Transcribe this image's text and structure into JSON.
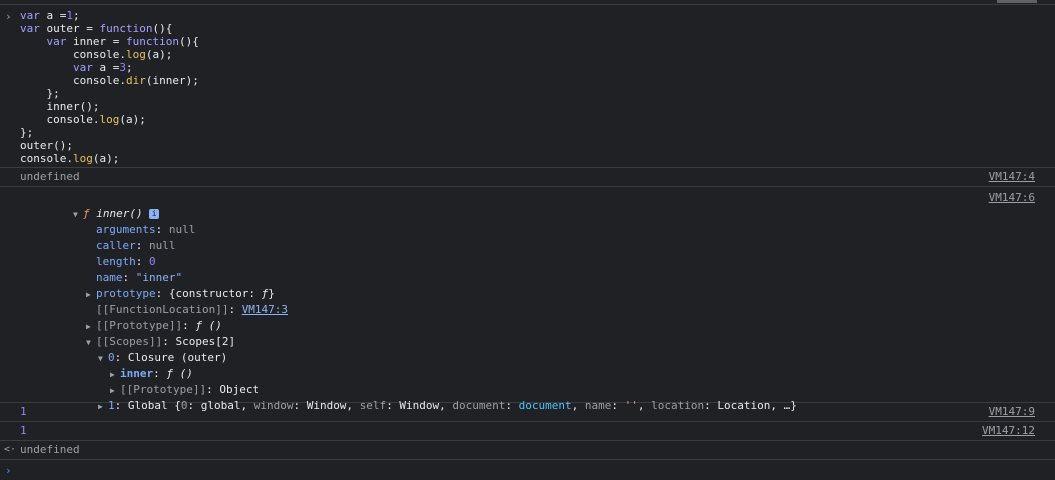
{
  "code_lines": [
    [
      {
        "t": "var ",
        "c": "kw"
      },
      {
        "t": "a =",
        "c": "plain"
      },
      {
        "t": "1",
        "c": "num"
      },
      {
        "t": ";",
        "c": "plain"
      }
    ],
    [
      {
        "t": "var ",
        "c": "kw"
      },
      {
        "t": "outer = ",
        "c": "plain"
      },
      {
        "t": "function",
        "c": "kw"
      },
      {
        "t": "(){",
        "c": "plain"
      }
    ],
    [
      {
        "t": "    var ",
        "c": "kw"
      },
      {
        "t": "inner = ",
        "c": "plain"
      },
      {
        "t": "function",
        "c": "kw"
      },
      {
        "t": "(){",
        "c": "plain"
      }
    ],
    [
      {
        "t": "        console.",
        "c": "plain"
      },
      {
        "t": "log",
        "c": "fn"
      },
      {
        "t": "(a);",
        "c": "plain"
      }
    ],
    [
      {
        "t": "        var ",
        "c": "kw"
      },
      {
        "t": "a =",
        "c": "plain"
      },
      {
        "t": "3",
        "c": "num"
      },
      {
        "t": ";",
        "c": "plain"
      }
    ],
    [
      {
        "t": "        console.",
        "c": "plain"
      },
      {
        "t": "dir",
        "c": "fn"
      },
      {
        "t": "(inner);",
        "c": "plain"
      }
    ],
    [
      {
        "t": "    };",
        "c": "plain"
      }
    ],
    [
      {
        "t": "    inner();",
        "c": "plain"
      }
    ],
    [
      {
        "t": "    console.",
        "c": "plain"
      },
      {
        "t": "log",
        "c": "fn"
      },
      {
        "t": "(a);",
        "c": "plain"
      }
    ],
    [
      {
        "t": "};",
        "c": "plain"
      }
    ],
    [
      {
        "t": "outer();",
        "c": "plain"
      }
    ],
    [
      {
        "t": "console.",
        "c": "plain"
      },
      {
        "t": "log",
        "c": "fn"
      },
      {
        "t": "(a);",
        "c": "plain"
      }
    ]
  ],
  "entries": {
    "undefined1": {
      "text": "undefined",
      "source": "VM147:4"
    },
    "dir_source": "VM147:6",
    "log1": {
      "text": "1",
      "source": "VM147:9"
    },
    "log2": {
      "text": "1",
      "source": "VM147:12"
    },
    "undefined2": {
      "text": "undefined"
    }
  },
  "tree": {
    "f_symbol": "ƒ",
    "fn_name": "inner()",
    "info_badge": "i",
    "arguments_key": "arguments",
    "arguments_val": "null",
    "caller_key": "caller",
    "caller_val": "null",
    "length_key": "length",
    "length_val": "0",
    "name_key": "name",
    "name_val": "\"inner\"",
    "prototype_key": "prototype",
    "prototype_val_pre": "{constructor: ",
    "prototype_val_f": "ƒ",
    "prototype_val_post": "}",
    "fnloc_key": "[[FunctionLocation]]",
    "fnloc_val": "VM147:3",
    "proto_key": "[[Prototype]]",
    "proto_val": "ƒ ()",
    "scopes_key": "[[Scopes]]",
    "scopes_val": "Scopes[2]",
    "scope0_key": "0",
    "scope0_val": "Closure (outer)",
    "inner_key": "inner",
    "inner_val": "ƒ ()",
    "scope0_proto_key": "[[Prototype]]",
    "scope0_proto_val": "Object",
    "scope1_key": "1",
    "scope1_parts": [
      {
        "t": "Global {",
        "c": "plain"
      },
      {
        "t": "0",
        "c": "pkd"
      },
      {
        "t": ": global, ",
        "c": "plain"
      },
      {
        "t": "window",
        "c": "pkd"
      },
      {
        "t": ": Window, ",
        "c": "plain"
      },
      {
        "t": "self",
        "c": "pkd"
      },
      {
        "t": ": Window, ",
        "c": "plain"
      },
      {
        "t": "document",
        "c": "pkd"
      },
      {
        "t": ": ",
        "c": "plain"
      },
      {
        "t": "document",
        "c": "blue"
      },
      {
        "t": ", ",
        "c": "plain"
      },
      {
        "t": "name",
        "c": "pkd"
      },
      {
        "t": ": ",
        "c": "plain"
      },
      {
        "t": "''",
        "c": "strg"
      },
      {
        "t": ", ",
        "c": "plain"
      },
      {
        "t": "location",
        "c": "pkd"
      },
      {
        "t": ": Location, …}",
        "c": "plain"
      }
    ]
  },
  "icons": {
    "prompt": "chevron-right-icon",
    "return": "return-arrow-icon"
  }
}
